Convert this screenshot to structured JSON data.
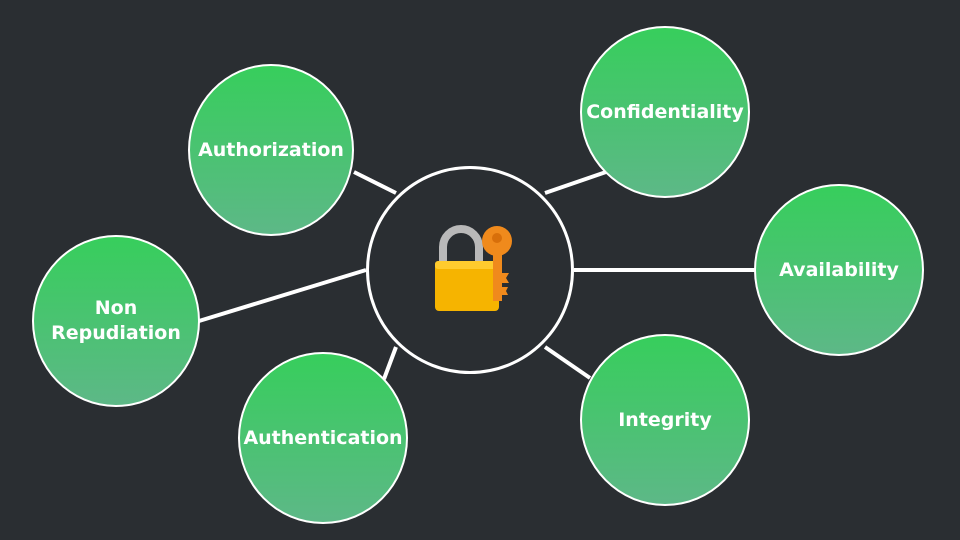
{
  "center": {
    "icon": "locked-with-key-icon"
  },
  "nodes": {
    "authorization": "Authorization",
    "confidentiality": "Confidentiality",
    "availability": "Availability",
    "non_repudiation": "Non\nRepudiation",
    "authentication": "Authentication",
    "integrity": "Integrity"
  },
  "colors": {
    "background": "#2a2e32",
    "node_top": "#37ce5c",
    "node_bottom": "#5db887",
    "line": "#ffffff",
    "lock_body": "#f6b400",
    "lock_shackle": "#b9b9b9",
    "key": "#f08a1c"
  }
}
